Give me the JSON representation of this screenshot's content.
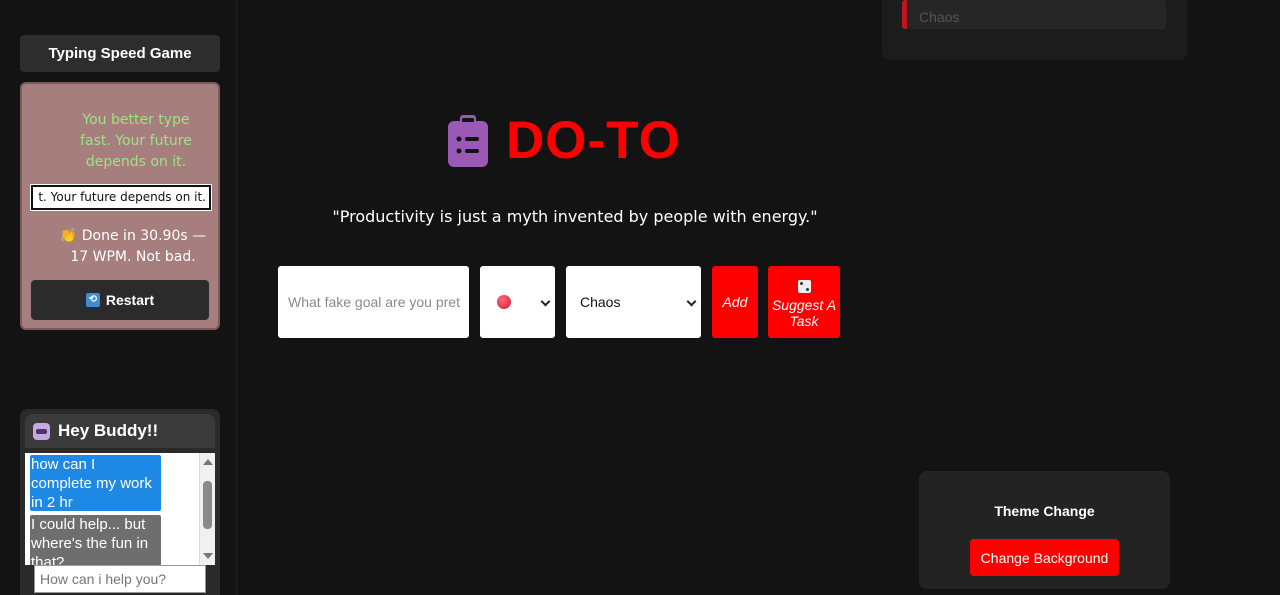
{
  "game": {
    "title": "Typing Speed Game",
    "prompt": "You better type fast. Your future depends on it.",
    "input_value": "t. Your future depends on it.",
    "result": "👏 Done in 30.90s — 17 WPM. Not bad.",
    "restart_label": "Restart"
  },
  "chat": {
    "title": "Hey Buddy!!",
    "messages": [
      {
        "role": "user",
        "text": "how can I complete my work in 2 hr"
      },
      {
        "role": "bot",
        "text": "I could help... but where's the fun in that?"
      }
    ],
    "input_placeholder": "How can i help you?"
  },
  "top_card": {
    "item": "Chaos"
  },
  "app": {
    "title": "DO-TO",
    "quote": "\"Productivity is just a myth invented by people with energy.\""
  },
  "task_form": {
    "input_placeholder": "What fake goal are you pret",
    "category_value": "Chaos",
    "add_label": "Add",
    "suggest_label": "Suggest A Task"
  },
  "theme": {
    "title": "Theme Change",
    "button_label": "Change Background"
  },
  "colors": {
    "accent": "#ff0000",
    "background": "#141314",
    "game_card": "#a67e7e",
    "prompt_text": "#9ae67f",
    "user_bubble": "#1e88e5"
  }
}
